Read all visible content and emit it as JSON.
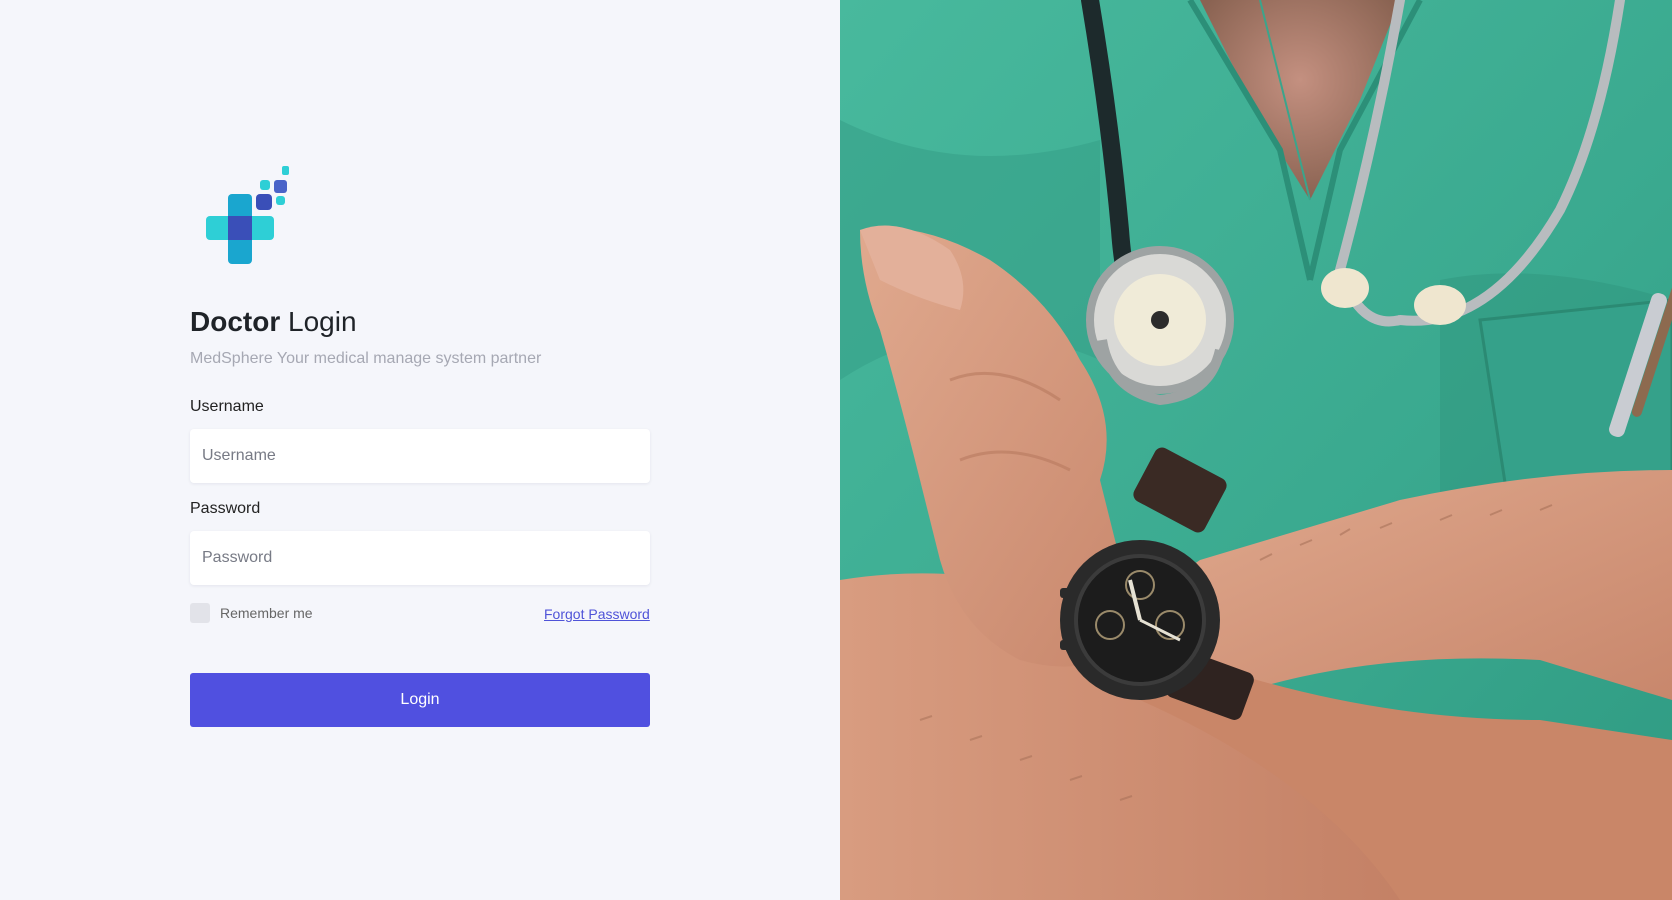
{
  "brand": {
    "logo_icon": "medical-cross-logo-icon",
    "tagline": "MedSphere Your medical manage system partner"
  },
  "login_form": {
    "title_bold": "Doctor",
    "title_light": "Login",
    "username_label": "Username",
    "username_placeholder": "Username",
    "username_value": "",
    "password_label": "Password",
    "password_placeholder": "Password",
    "password_value": "",
    "remember_label": "Remember me",
    "remember_checked": false,
    "forgot_link": "Forgot Password",
    "submit_label": "Login"
  },
  "hero_image": {
    "subject": "doctor-scrubs-stethoscope-watch-photo"
  },
  "colors": {
    "background": "#f5f6fb",
    "primary": "#5050e0",
    "link": "#4f53d8",
    "logo_teal": "#2ecfd6",
    "logo_blue": "#3a4fb8",
    "scrubs_green": "#3fae94"
  }
}
